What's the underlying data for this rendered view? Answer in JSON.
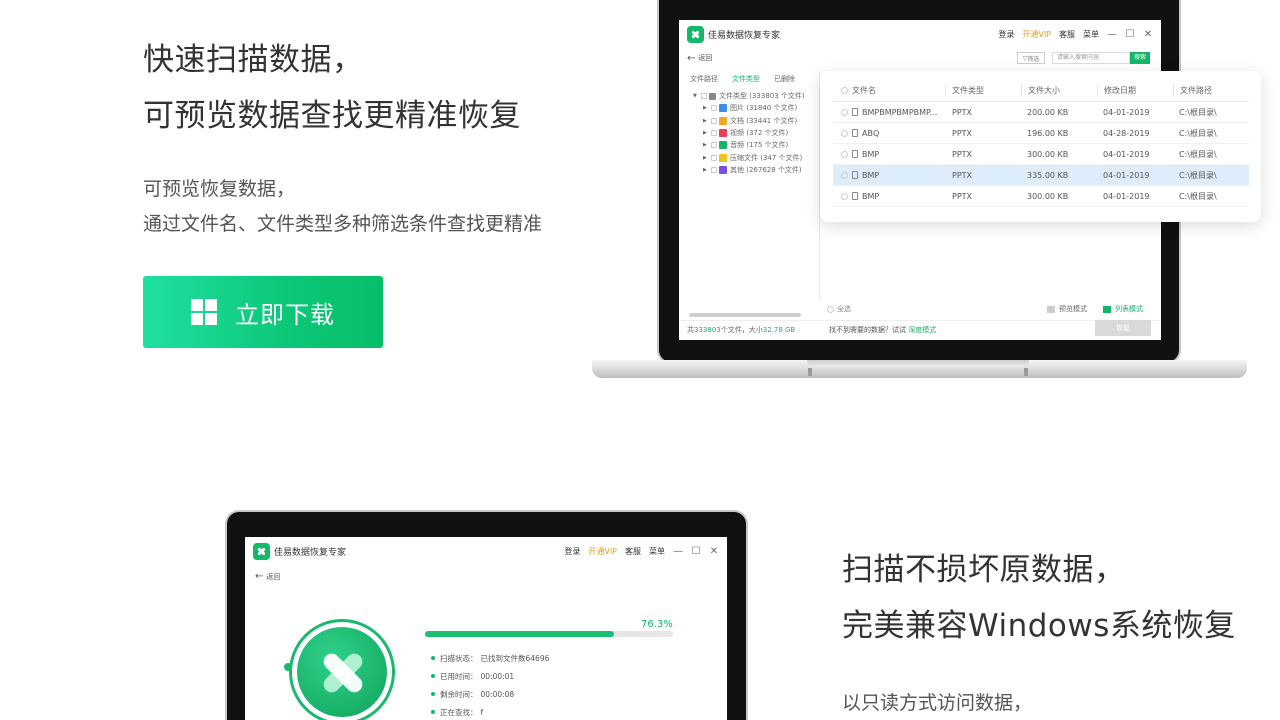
{
  "section1": {
    "headline": [
      "快速扫描数据，",
      "可预览数据查找更精准恢复"
    ],
    "sub": [
      "可预览恢复数据，",
      "通过文件名、文件类型多种筛选条件查找更精准"
    ],
    "download_label": "立即下载"
  },
  "app": {
    "name": "佳易数据恢复专家",
    "nav": {
      "login": "登录",
      "vip": "开通VIP",
      "service": "客服",
      "menu": "菜单"
    },
    "win_controls": {
      "minimize": "—",
      "maximize": "☐",
      "close": "✕"
    },
    "back_label": "返回",
    "filter_label": "筛选",
    "search_placeholder": "请输入搜索内容",
    "search_button": "搜索",
    "tree_tabs": [
      "文件路径",
      "文件类型",
      "已删除"
    ],
    "tree": {
      "root": "文件类型 (333803 个文件)",
      "items": [
        {
          "label": "图片 (31840 个文件)",
          "color": "#3c8fe8"
        },
        {
          "label": "文档 (33441 个文件)",
          "color": "#f5a623"
        },
        {
          "label": "视频 (372 个文件)",
          "color": "#e8405a"
        },
        {
          "label": "音频 (175 个文件)",
          "color": "#14b56a"
        },
        {
          "label": "压缩文件 (347 个文件)",
          "color": "#f4c21b"
        },
        {
          "label": "其他 (267628 个文件)",
          "color": "#7b4fe0"
        }
      ]
    },
    "select_all": "全选",
    "preview_mode": "预览模式",
    "list_mode": "列表模式",
    "status": {
      "prefix": "共",
      "count": "333803",
      "mid": "个文件，大小",
      "size": "32.78 GB"
    },
    "hint": {
      "text": "找不到需要的数据？试试",
      "link": "深度模式"
    },
    "restore_button": "恢复",
    "table": {
      "headers": [
        "文件名",
        "文件类型",
        "文件大小",
        "修改日期",
        "文件路径"
      ],
      "rows": [
        {
          "name": "BMPBMPBMPBMP...",
          "type": "PPTX",
          "size": "200.00 KB",
          "date": "04-01-2019",
          "path": "C:\\根目录\\",
          "selected": false
        },
        {
          "name": "ABQ",
          "type": "PPTX",
          "size": "196.00 KB",
          "date": "04-28-2019",
          "path": "C:\\根目录\\",
          "selected": false
        },
        {
          "name": "BMP",
          "type": "PPTX",
          "size": "300.00 KB",
          "date": "04-01-2019",
          "path": "C:\\根目录\\",
          "selected": false
        },
        {
          "name": "BMP",
          "type": "PPTX",
          "size": "335.00 KB",
          "date": "04-01-2019",
          "path": "C:\\根目录\\",
          "selected": true
        },
        {
          "name": "BMP",
          "type": "PPTX",
          "size": "300.00 KB",
          "date": "04-01-2019",
          "path": "C:\\根目录\\",
          "selected": false
        }
      ]
    }
  },
  "scan": {
    "percent_label": "76.3%",
    "progress": 0.763,
    "items": [
      {
        "label": "扫描状态：",
        "value": "已找到文件数64696"
      },
      {
        "label": "已用时间：",
        "value": "00:00:01"
      },
      {
        "label": "剩余时间：",
        "value": "00:00:08"
      },
      {
        "label": "正在查找：",
        "value": "f"
      }
    ]
  },
  "section2": {
    "headline": [
      "扫描不损坏原数据，",
      "完美兼容Windows系统恢复"
    ],
    "sub": [
      "以只读方式访问数据，"
    ]
  },
  "colors": {
    "brand_green": "#14b56a",
    "vip_orange": "#f09a16",
    "selected_row": "#ddeefa"
  }
}
